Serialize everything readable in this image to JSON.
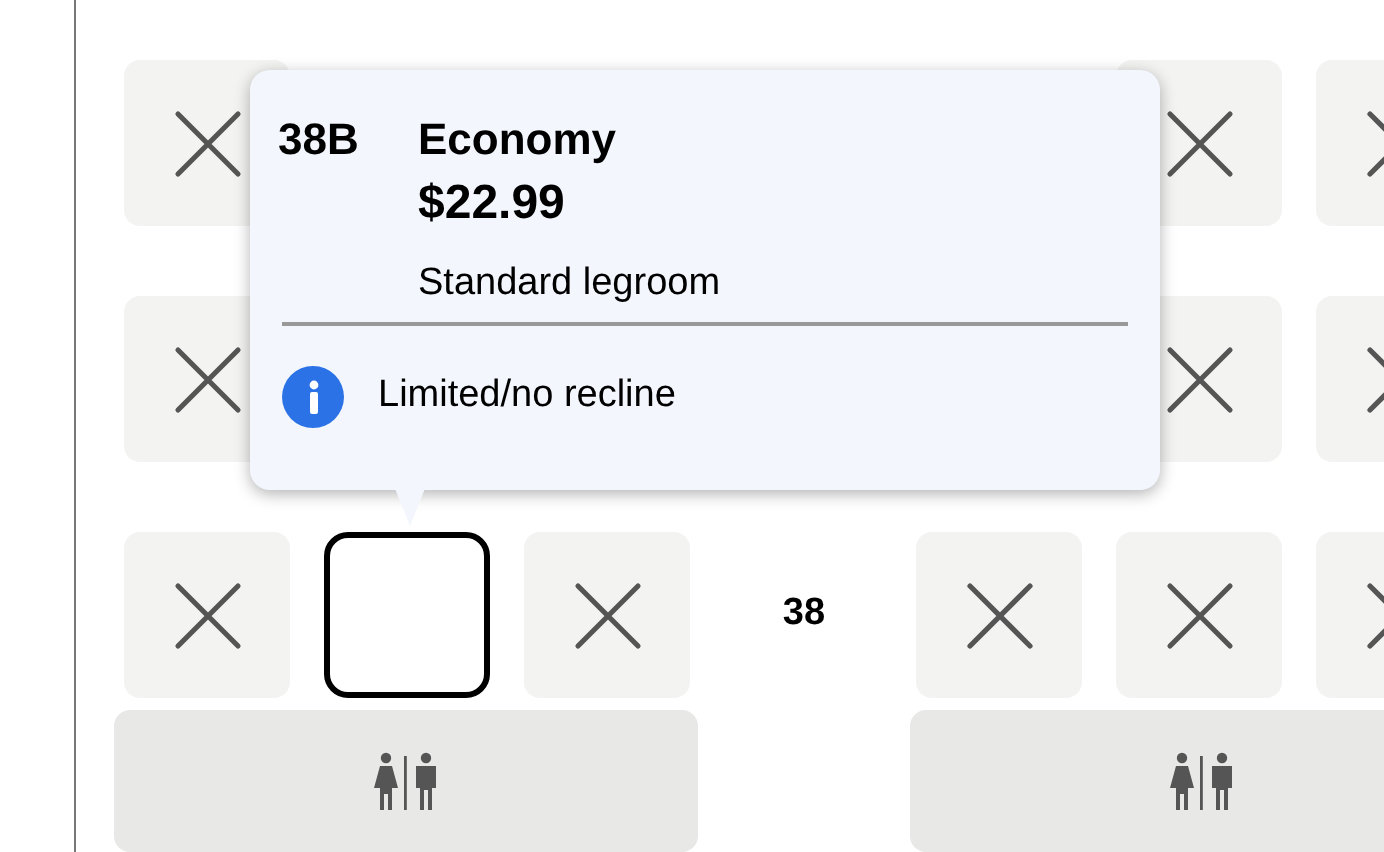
{
  "seat_rows": [
    {
      "seats": [
        {
          "kind": "unavailable"
        },
        {
          "kind": "hidden"
        },
        {
          "kind": "hidden"
        },
        {
          "kind": "hidden"
        },
        {
          "kind": "unavailable"
        },
        {
          "kind": "unavailable"
        }
      ]
    },
    {
      "seats": [
        {
          "kind": "unavailable"
        },
        {
          "kind": "hidden"
        },
        {
          "kind": "hidden"
        },
        {
          "kind": "hidden"
        },
        {
          "kind": "unavailable"
        },
        {
          "kind": "unavailable"
        }
      ]
    },
    {
      "row_number": "38",
      "seats": [
        {
          "kind": "unavailable"
        },
        {
          "kind": "selected"
        },
        {
          "kind": "unavailable"
        },
        {
          "kind": "unavailable"
        },
        {
          "kind": "unavailable"
        },
        {
          "kind": "unavailable"
        }
      ]
    }
  ],
  "lavatories": [
    {
      "kind": "restroom"
    },
    {
      "kind": "restroom"
    }
  ],
  "seat_tooltip": {
    "seat": "38B",
    "cabin": "Economy",
    "price": "$22.99",
    "legroom": "Standard legroom",
    "notes": [
      {
        "kind": "info",
        "text": "Limited/no recline"
      }
    ]
  }
}
